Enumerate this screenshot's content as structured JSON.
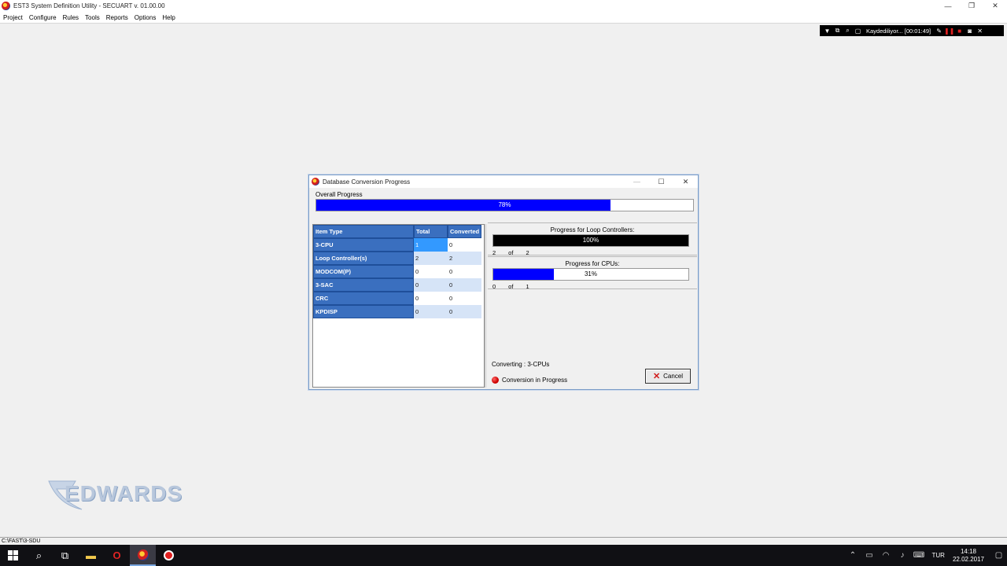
{
  "app": {
    "title": "EST3 System Definition Utility - SECUART v. 01.00.00",
    "window_controls": {
      "minimize": "—",
      "maximize": "❐",
      "close": "✕"
    }
  },
  "menu": [
    "Project",
    "Configure",
    "Rules",
    "Tools",
    "Reports",
    "Options",
    "Help"
  ],
  "recorder": {
    "label": "Kaydediliyor... [00:01:49]"
  },
  "logo": {
    "text": "EDWARDS"
  },
  "status_path": "C:\\FAST\\3-SDU",
  "dialog": {
    "title": "Database Conversion Progress",
    "overall_label": "Overall Progress",
    "overall_percent_text": "78%",
    "overall_fraction": 0.78,
    "table": {
      "headers": [
        "Item Type",
        "Total",
        "Converted"
      ],
      "rows": [
        {
          "type": "3-CPU",
          "total": "1",
          "converted": "0"
        },
        {
          "type": "Loop Controller(s)",
          "total": "2",
          "converted": "2"
        },
        {
          "type": "MODCOM(P)",
          "total": "0",
          "converted": "0"
        },
        {
          "type": "3-SAC",
          "total": "0",
          "converted": "0"
        },
        {
          "type": "CRC",
          "total": "0",
          "converted": "0"
        },
        {
          "type": "KPDISP",
          "total": "0",
          "converted": "0"
        }
      ]
    },
    "loop": {
      "title": "Progress for Loop Controllers:",
      "percent_text": "100%",
      "fraction": 1.0,
      "fill_color": "#000000",
      "done": "2",
      "of": "of",
      "total": "2"
    },
    "cpu": {
      "title": "Progress for CPUs:",
      "percent_text": "31%",
      "fraction": 0.31,
      "fill_color": "#0000ff",
      "done": "0",
      "of": "of",
      "total": "1"
    },
    "converting_text": "Converting : 3-CPUs",
    "status_text": "Conversion in Progress",
    "cancel_label": "Cancel"
  },
  "tray": {
    "language": "TUR",
    "time": "14:18",
    "date": "22.02.2017"
  }
}
